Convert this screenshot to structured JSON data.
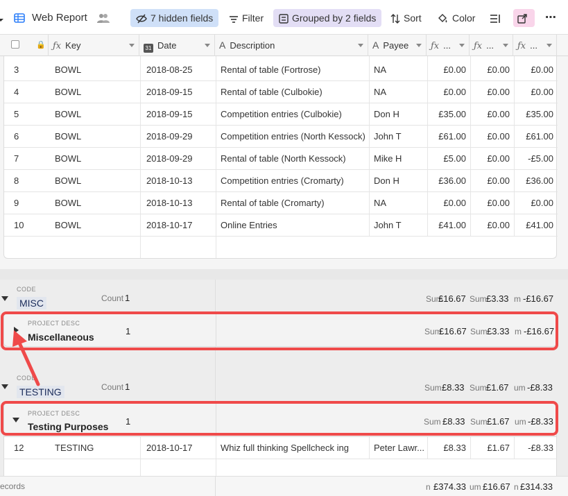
{
  "toolbar": {
    "view_name": "Web Report",
    "hidden_fields": "7 hidden fields",
    "filter": "Filter",
    "grouped": "Grouped by 2 fields",
    "sort": "Sort",
    "color": "Color"
  },
  "columns": {
    "key": "Key",
    "date": "Date",
    "description": "Description",
    "payee": "Payee",
    "f1": "...",
    "f2": "...",
    "f3": "..."
  },
  "rows": [
    {
      "n": "3",
      "key": "BOWL",
      "date": "2018-08-25",
      "desc": "Rental of table (Fortrose)",
      "payee": "NA",
      "a": "£0.00",
      "b": "£0.00",
      "c": "£0.00"
    },
    {
      "n": "4",
      "key": "BOWL",
      "date": "2018-09-15",
      "desc": "Rental of table (Culbokie)",
      "payee": "NA",
      "a": "£0.00",
      "b": "£0.00",
      "c": "£0.00"
    },
    {
      "n": "5",
      "key": "BOWL",
      "date": "2018-09-15",
      "desc": "Competition entries (Culbokie)",
      "payee": "Don H",
      "a": "£35.00",
      "b": "£0.00",
      "c": "£35.00"
    },
    {
      "n": "6",
      "key": "BOWL",
      "date": "2018-09-29",
      "desc": "Competition entries (North Kessock)",
      "payee": "John T",
      "a": "£61.00",
      "b": "£0.00",
      "c": "£61.00"
    },
    {
      "n": "7",
      "key": "BOWL",
      "date": "2018-09-29",
      "desc": "Rental of table (North Kessock)",
      "payee": "Mike H",
      "a": "£5.00",
      "b": "£0.00",
      "c": "-£5.00"
    },
    {
      "n": "8",
      "key": "BOWL",
      "date": "2018-10-13",
      "desc": "Competition entries (Cromarty)",
      "payee": "Don H",
      "a": "£36.00",
      "b": "£0.00",
      "c": "£36.00"
    },
    {
      "n": "9",
      "key": "BOWL",
      "date": "2018-10-13",
      "desc": "Rental of table (Cromarty)",
      "payee": "NA",
      "a": "£0.00",
      "b": "£0.00",
      "c": "£0.00"
    },
    {
      "n": "10",
      "key": "BOWL",
      "date": "2018-10-17",
      "desc": "Online Entries",
      "payee": "John T",
      "a": "£41.00",
      "b": "£0.00",
      "c": "£41.00"
    }
  ],
  "groups": {
    "misc": {
      "code_label": "CODE",
      "code": "MISC",
      "count_label": "Count",
      "count": "1",
      "sum_a_prefix": "Sum",
      "sum_a": "£16.67",
      "sum_b_prefix": "Sum",
      "sum_b": "£3.33",
      "sum_c_prefix": "m",
      "sum_c": "-£16.67",
      "proj_label": "PROJECT DESC",
      "proj": "Miscellaneous",
      "proj_count": "1",
      "proj_sum_a_prefix": "Sum",
      "proj_sum_a": "£16.67",
      "proj_sum_b_prefix": "Sum",
      "proj_sum_b": "£3.33",
      "proj_sum_c_prefix": "m",
      "proj_sum_c": "-£16.67"
    },
    "testing": {
      "code_label": "CODE",
      "code": "TESTING",
      "count_label": "Count",
      "count": "1",
      "sum_a_prefix": "Sum",
      "sum_a": "£8.33",
      "sum_b_prefix": "Sum",
      "sum_b": "£1.67",
      "sum_c_prefix": "um",
      "sum_c": "-£8.33",
      "proj_label": "PROJECT DESC",
      "proj": "Testing Purposes",
      "proj_count": "1",
      "proj_sum_a_prefix": "Sum",
      "proj_sum_a": "£8.33",
      "proj_sum_b_prefix": "Sum",
      "proj_sum_b": "£1.67",
      "proj_sum_c_prefix": "um",
      "proj_sum_c": "-£8.33"
    }
  },
  "testing_row": {
    "n": "12",
    "key": "TESTING",
    "date": "2018-10-17",
    "desc": "Whiz full thinking Spellcheck ing",
    "payee": "Peter Lawr...",
    "a": "£8.33",
    "b": "£1.67",
    "c": "-£8.33"
  },
  "footer": {
    "records": "ecords",
    "sum_a_prefix": "n",
    "sum_a": "£374.33",
    "sum_b_prefix": "um",
    "sum_b": "£16.67",
    "sum_c_prefix": "n",
    "sum_c": "£314.33"
  },
  "colors": {
    "accent_blue": "#cfe0f8",
    "accent_purple": "#e3def5",
    "accent_pink": "#f9d5ea",
    "annotation_red": "#ef4a4a"
  }
}
